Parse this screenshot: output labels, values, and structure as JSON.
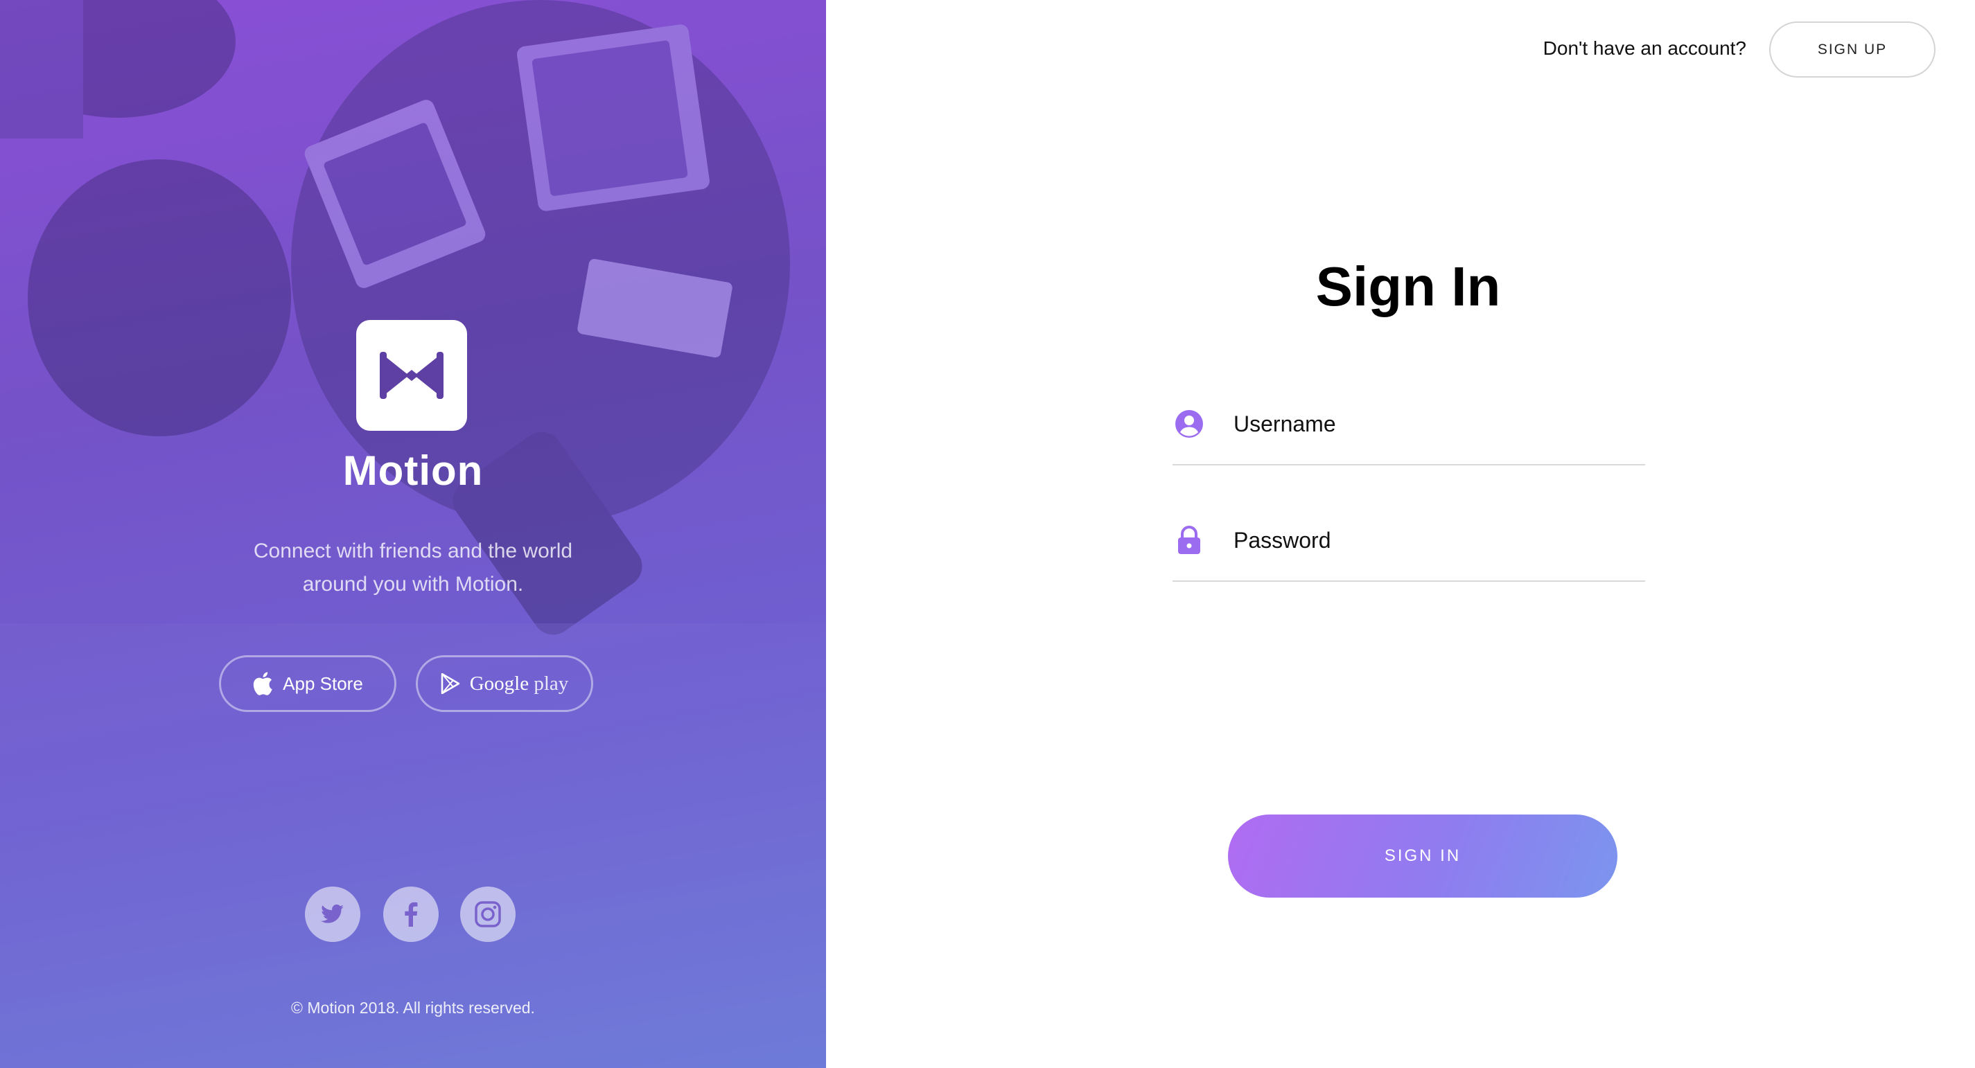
{
  "brand": {
    "name": "Motion",
    "tagline_line1": "Connect with friends and the world",
    "tagline_line2": "around you with Motion."
  },
  "stores": {
    "app_store_label": "App Store",
    "google_play_label": "Google",
    "google_play_suffix": "play"
  },
  "social": {
    "icons": [
      "twitter-icon",
      "facebook-icon",
      "instagram-icon"
    ]
  },
  "footer": {
    "copyright": "© Motion 2018. All rights reserved."
  },
  "header": {
    "question": "Don't have an account?",
    "signup_label": "SIGN UP"
  },
  "form": {
    "title": "Sign In",
    "username_placeholder": "Username",
    "password_placeholder": "Password",
    "submit_label": "SIGN IN"
  },
  "colors": {
    "accent": "#9b6cf0",
    "gradient_start": "#b06cf2",
    "gradient_end": "#7b95ee",
    "left_panel": "#7552c8"
  }
}
